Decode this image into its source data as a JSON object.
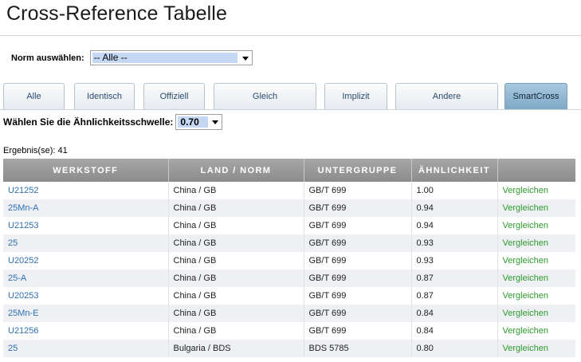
{
  "page": {
    "title": "Cross-Reference Tabelle"
  },
  "norm": {
    "label": "Norm auswählen:",
    "selected": "-- Alle --"
  },
  "tabs": [
    {
      "label": "Alle",
      "active": false
    },
    {
      "label": "Identisch",
      "active": false
    },
    {
      "label": "Offiziell",
      "active": false
    },
    {
      "label": "Gleich",
      "active": false
    },
    {
      "label": "Implizit",
      "active": false
    },
    {
      "label": "Andere",
      "active": false
    },
    {
      "label": "SmartCross",
      "active": true
    }
  ],
  "threshold": {
    "label": "Wählen Sie die Ähnlichkeitsschwelle:",
    "selected": "0.70"
  },
  "result": {
    "label": "Ergebnis(se): 41"
  },
  "table": {
    "columns": [
      "WERKSTOFF",
      "LAND / NORM",
      "UNTERGRUPPE",
      "ÄHNLICHKEIT",
      ""
    ],
    "action_label": "Vergleichen",
    "rows": [
      {
        "werkstoff": "U21252",
        "land": "China / GB",
        "untergruppe": "GB/T 699",
        "aehnlichkeit": "1.00"
      },
      {
        "werkstoff": "25Mn-A",
        "land": "China / GB",
        "untergruppe": "GB/T 699",
        "aehnlichkeit": "0.94"
      },
      {
        "werkstoff": "U21253",
        "land": "China / GB",
        "untergruppe": "GB/T 699",
        "aehnlichkeit": "0.94"
      },
      {
        "werkstoff": "25",
        "land": "China / GB",
        "untergruppe": "GB/T 699",
        "aehnlichkeit": "0.93"
      },
      {
        "werkstoff": "U20252",
        "land": "China / GB",
        "untergruppe": "GB/T 699",
        "aehnlichkeit": "0.93"
      },
      {
        "werkstoff": "25-A",
        "land": "China / GB",
        "untergruppe": "GB/T 699",
        "aehnlichkeit": "0.87"
      },
      {
        "werkstoff": "U20253",
        "land": "China / GB",
        "untergruppe": "GB/T 699",
        "aehnlichkeit": "0.87"
      },
      {
        "werkstoff": "25Mn-E",
        "land": "China / GB",
        "untergruppe": "GB/T 699",
        "aehnlichkeit": "0.84"
      },
      {
        "werkstoff": "U21256",
        "land": "China / GB",
        "untergruppe": "GB/T 699",
        "aehnlichkeit": "0.84"
      },
      {
        "werkstoff": "25",
        "land": "Bulgaria / BDS",
        "untergruppe": "BDS 5785",
        "aehnlichkeit": "0.80"
      }
    ]
  },
  "colors": {
    "link": "#2f6fb0",
    "compare": "#2e9a2e",
    "header_bg": "#999999",
    "active_tab": "#8fb5d0",
    "selection": "#c5d8f3"
  }
}
